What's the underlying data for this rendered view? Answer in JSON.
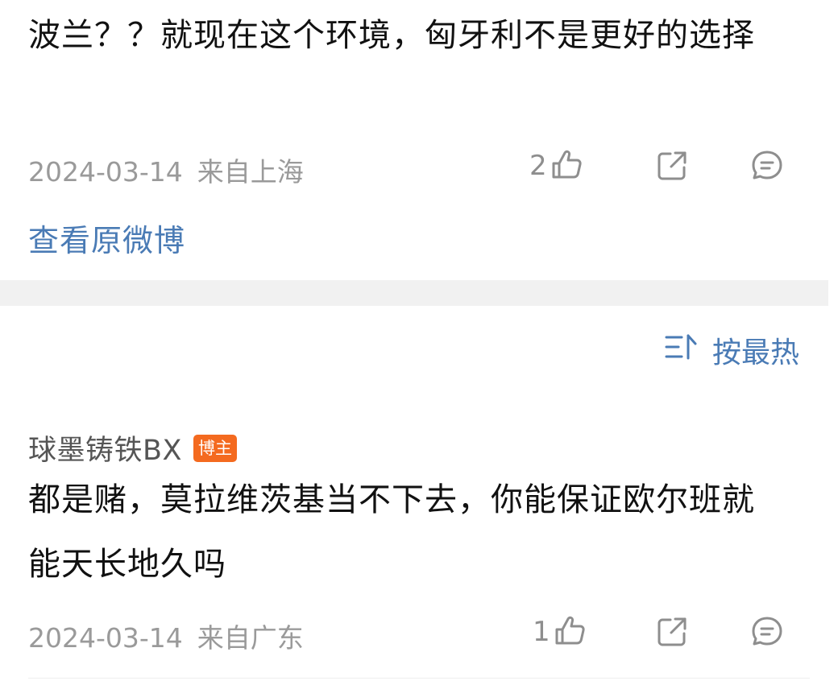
{
  "main_post": {
    "text": "波兰？？就现在这个环境，匈牙利不是更好的选择",
    "date": "2024-03-14",
    "location": "来自上海",
    "likes": "2",
    "view_original": "查看原微博"
  },
  "sort": {
    "label": "按最热",
    "icon": "sort-icon"
  },
  "comment": {
    "author": "球墨铸铁BX",
    "badge": "博主",
    "text": "都是赌，莫拉维茨基当不下去，你能保证欧尔班就能天长地久吗",
    "date": "2024-03-14",
    "location": "来自广东",
    "likes": "1"
  },
  "icons": {
    "like": "thumbs-up-icon",
    "share": "share-icon",
    "comment": "comment-icon"
  },
  "colors": {
    "link_blue": "#4a7bb5",
    "meta_gray": "#9a9a9a",
    "badge_orange": "#f46a1f",
    "divider_gray": "#f1f1f1"
  }
}
